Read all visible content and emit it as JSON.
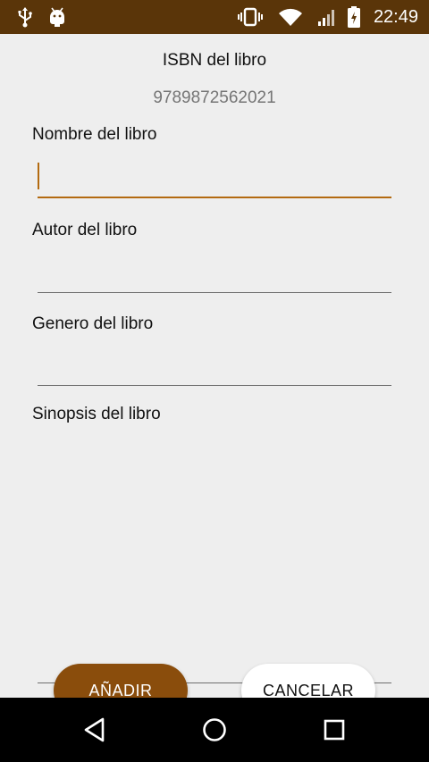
{
  "status_bar": {
    "time": "22:49",
    "background": "#5a3509",
    "icons": [
      "usb-icon",
      "android-debug-icon",
      "vibrate-icon",
      "wifi-icon",
      "signal-icon",
      "battery-charging-icon"
    ]
  },
  "form": {
    "isbn_title": "ISBN del libro",
    "isbn_value": "9789872562021",
    "fields": [
      {
        "label": "Nombre del libro",
        "value": "",
        "focused": true
      },
      {
        "label": "Autor del libro",
        "value": ""
      },
      {
        "label": "Genero del libro",
        "value": ""
      },
      {
        "label": "Sinopsis del libro",
        "value": ""
      }
    ],
    "accent": "#b36a10"
  },
  "buttons": {
    "add_label": "AÑADIR",
    "cancel_label": "CANCELAR",
    "add_color": "#8a4d0c"
  },
  "nav_bar": {
    "icons": [
      "back-icon",
      "home-icon",
      "recents-icon"
    ]
  }
}
